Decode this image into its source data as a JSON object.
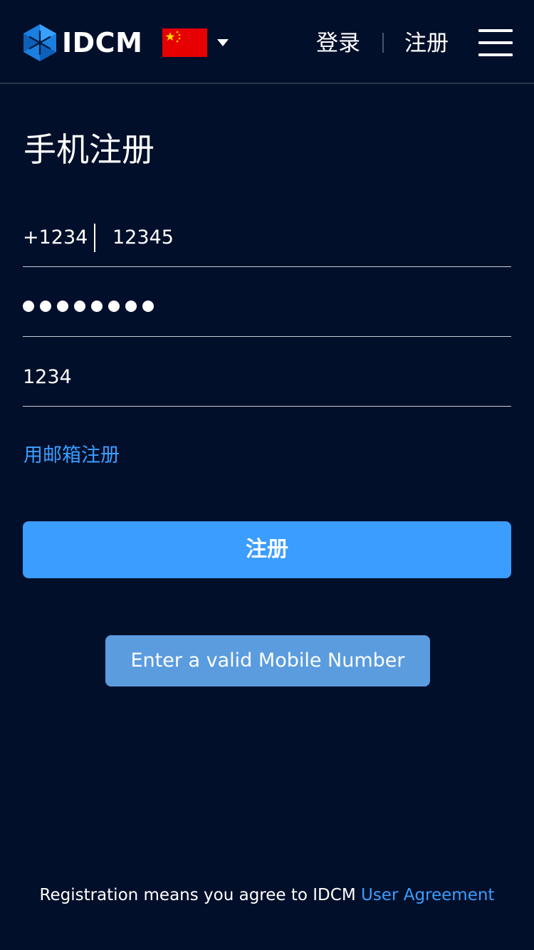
{
  "header": {
    "logo_text": "IDCM",
    "flag_icon": "china-flag-icon",
    "login_label": "登录",
    "register_label": "注册"
  },
  "colors": {
    "background": "#020f2a",
    "accent": "#3b9dff",
    "toast": "#5b9cdf"
  },
  "form": {
    "title": "手机注册",
    "country_code": "+1234",
    "phone": "12345",
    "password_dot_count": 8,
    "code": "1234",
    "email_link": "用邮箱注册",
    "submit_label": "注册"
  },
  "toast": {
    "message": "Enter a valid Mobile Number"
  },
  "footer": {
    "agreement_text": "Registration means you agree to IDCM ",
    "agreement_link": "User Agreement"
  }
}
